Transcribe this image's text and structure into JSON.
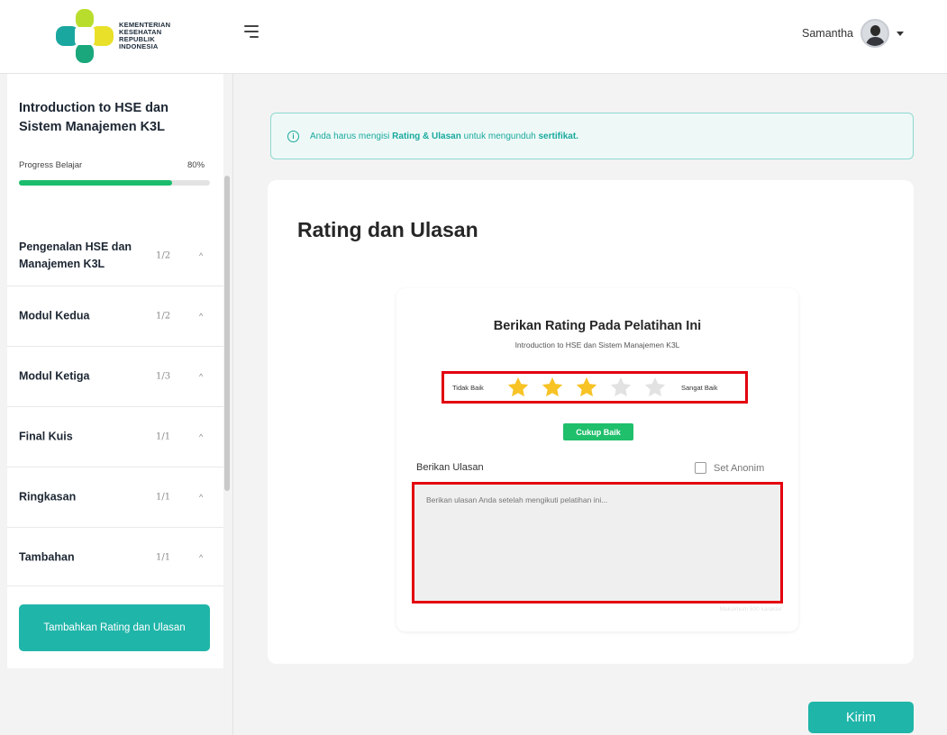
{
  "header": {
    "logo_text": [
      "KEMENTERIAN",
      "KESEHATAN",
      "REPUBLIK",
      "INDONESIA"
    ],
    "menu_icon": "hamburger-icon",
    "user_name": "Samantha",
    "user_dropdown_icon": "caret-down-icon"
  },
  "sidebar": {
    "course_title": "Introduction to HSE dan Sistem Manajemen K3L",
    "progress_label": "Progress Belajar",
    "progress_percent": "80%",
    "progress_value": 0.8,
    "modules": [
      {
        "name": "Pengenalan HSE dan Manajemen K3L",
        "count": "1/2"
      },
      {
        "name": "Modul Kedua",
        "count": "1/2"
      },
      {
        "name": "Modul Ketiga",
        "count": "1/3"
      },
      {
        "name": "Final Kuis",
        "count": "1/1"
      },
      {
        "name": "Ringkasan",
        "count": "1/1"
      },
      {
        "name": "Tambahan",
        "count": "1/1"
      }
    ],
    "chevron_glyph": "^",
    "rating_button_label": "Tambahkan Rating dan Ulasan"
  },
  "alert": {
    "icon": "info-icon",
    "text_before": "Anda harus mengisi ",
    "text_bold_1": "Rating & Ulasan",
    "text_middle": " untuk mengunduh ",
    "text_bold_2": "sertifikat."
  },
  "main": {
    "page_title": "Rating dan Ulasan",
    "card": {
      "title": "Berikan Rating Pada Pelatihan Ini",
      "subtitle": "Introduction to HSE dan Sistem Manajemen K3L",
      "rating_low_label": "Tidak Baik",
      "rating_high_label": "Sangat Baik",
      "rating_value": 3,
      "rating_max": 5,
      "rating_level_label": "Cukup Baik",
      "review_label": "Berikan Ulasan",
      "anonymous_label": "Set Anonim",
      "review_placeholder": "Berikan ulasan Anda setelah mengikuti pelatihan ini...",
      "char_limit_hint": "Maksimum 500 karakter"
    },
    "submit_label": "Kirim"
  },
  "colors": {
    "accent": "#20b5a9",
    "progress": "#1bbd6d",
    "star_active": "#f7c325",
    "star_inactive": "#e2e2e2",
    "highlight_box": "#e3000f"
  }
}
